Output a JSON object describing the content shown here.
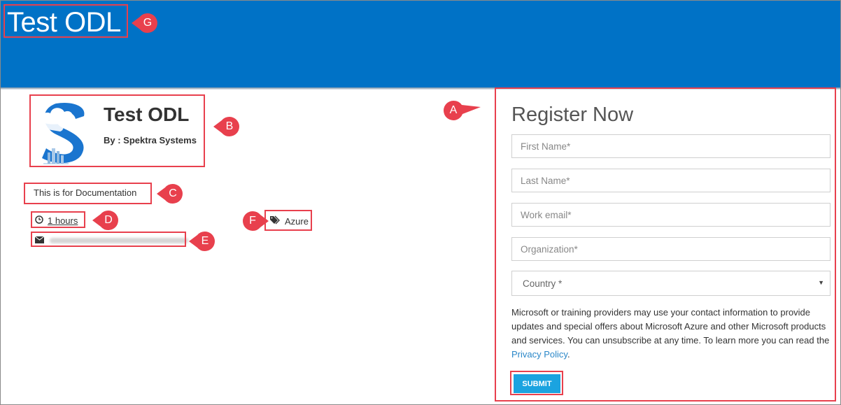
{
  "header": {
    "site_title": "Test ODL",
    "bg_color": "#0072c6"
  },
  "event": {
    "title": "Test ODL",
    "by_line": "By : Spektra Systems",
    "description": "This is for Documentation",
    "duration": "1 hours",
    "duration_icon": "clock-icon",
    "email_icon": "envelope-icon",
    "tag": "Azure",
    "tag_icon": "tags-icon"
  },
  "registration": {
    "title": "Register Now",
    "fields": {
      "first_name": "First Name*",
      "last_name": "Last Name*",
      "work_email": "Work email*",
      "organization": "Organization*"
    },
    "country": "Country *",
    "notice_text": "Microsoft or training providers may use your contact information to provide updates and special offers about Microsoft Azure and other Microsoft products and services. You can unsubscribe at any time. To learn more you can read the ",
    "privacy_link": "Privacy Policy",
    "notice_end": ".",
    "submit_label": "SUBMIT",
    "submit_color": "#1ba3e0"
  },
  "annotations": {
    "A": "A",
    "B": "B",
    "C": "C",
    "D": "D",
    "E": "E",
    "F": "F",
    "G": "G",
    "color": "#e8404d"
  }
}
